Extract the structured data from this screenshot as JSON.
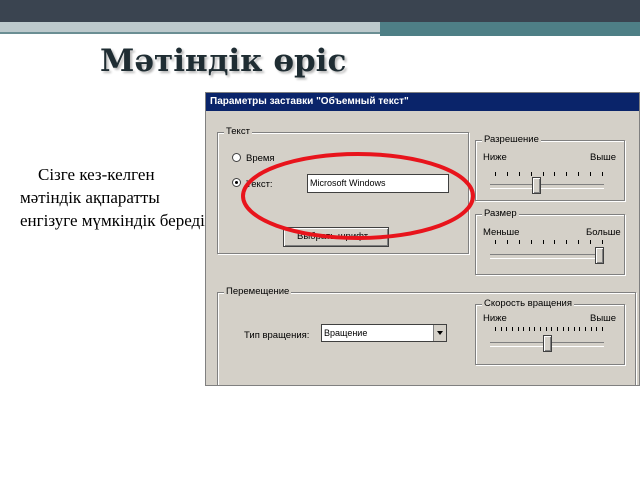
{
  "slide": {
    "title": "Мәтіндік өріс",
    "body": "Сізге кез-келген мәтіндік ақпаратты енгізуге мүмкіндік береді"
  },
  "dialog": {
    "title": "Параметры заставки \"Объемный текст\"",
    "text_group": {
      "label": "Текст",
      "radio_time": "Время",
      "radio_text": "Текст:",
      "text_value": "Microsoft Windows",
      "font_button": "Выбрать шрифт..."
    },
    "resolution": {
      "label": "Разрешение",
      "min": "Ниже",
      "max": "Выше",
      "value_fraction": 0.4
    },
    "size": {
      "label": "Размер",
      "min": "Меньше",
      "max": "Больше",
      "value_fraction": 1.0
    },
    "movement": {
      "label": "Перемещение",
      "rotation_type_label": "Тип вращения:",
      "rotation_type_value": "Вращение"
    },
    "rotation_speed": {
      "label": "Скорость вращения",
      "min": "Ниже",
      "max": "Выше",
      "value_fraction": 0.5
    }
  },
  "colors": {
    "highlight_ellipse": "#e8141c",
    "titlebar": "#0a246a",
    "dialog_bg": "#d4d0c8"
  }
}
